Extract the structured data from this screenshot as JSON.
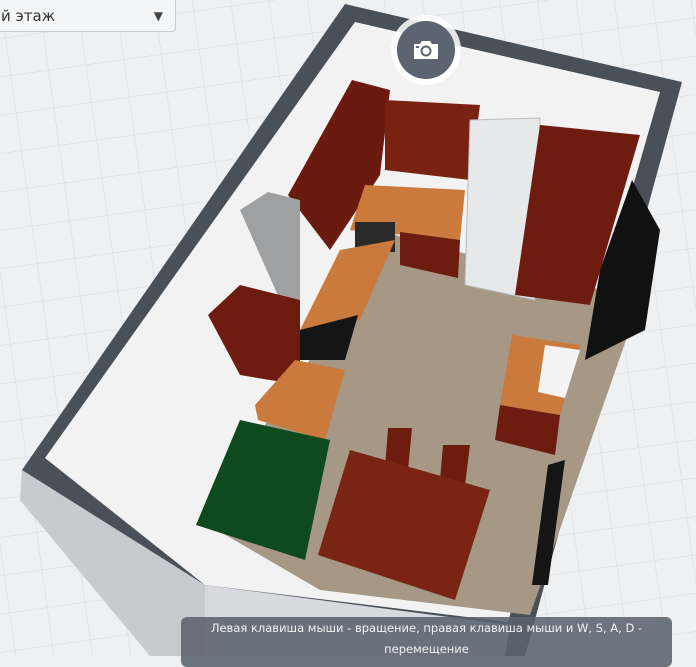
{
  "floor_selector": {
    "value": "й этаж",
    "arrow": "▼"
  },
  "camera_button": {
    "icon": "camera-icon"
  },
  "hint": {
    "text": "Левая клавиша мыши - вращение, правая клавиша мыши и W, S, A, D - перемещение"
  },
  "colors": {
    "wall": "#4a5058",
    "floor": "#a89a88",
    "cabinet": "#6e1c10",
    "countertop": "#c97a3c",
    "sofa": "#0f4a1c",
    "table": "#7a2414"
  }
}
